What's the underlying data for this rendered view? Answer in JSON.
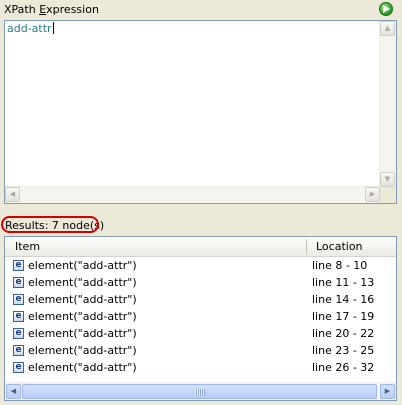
{
  "header": {
    "title_prefix": "XPath ",
    "title_mnemonic": "E",
    "title_suffix": "xpression",
    "run_icon": "run-play-icon"
  },
  "editor": {
    "value": "add-attr"
  },
  "results": {
    "label": "Results:  7 node(s)"
  },
  "table": {
    "columns": [
      "Item",
      "Location"
    ],
    "rows": [
      {
        "icon": "e",
        "item": "element(\"add-attr\")",
        "location": "line 8 - 10"
      },
      {
        "icon": "e",
        "item": "element(\"add-attr\")",
        "location": "line 11 - 13"
      },
      {
        "icon": "e",
        "item": "element(\"add-attr\")",
        "location": "line 14 - 16"
      },
      {
        "icon": "e",
        "item": "element(\"add-attr\")",
        "location": "line 17 - 19"
      },
      {
        "icon": "e",
        "item": "element(\"add-attr\")",
        "location": "line 20 - 22"
      },
      {
        "icon": "e",
        "item": "element(\"add-attr\")",
        "location": "line 23 - 25"
      },
      {
        "icon": "e",
        "item": "element(\"add-attr\")",
        "location": "line 26 - 32"
      }
    ]
  },
  "colors": {
    "editor_text": "#2b7d7d",
    "highlight_oval": "#d40000",
    "run_button": "#3aa531"
  }
}
